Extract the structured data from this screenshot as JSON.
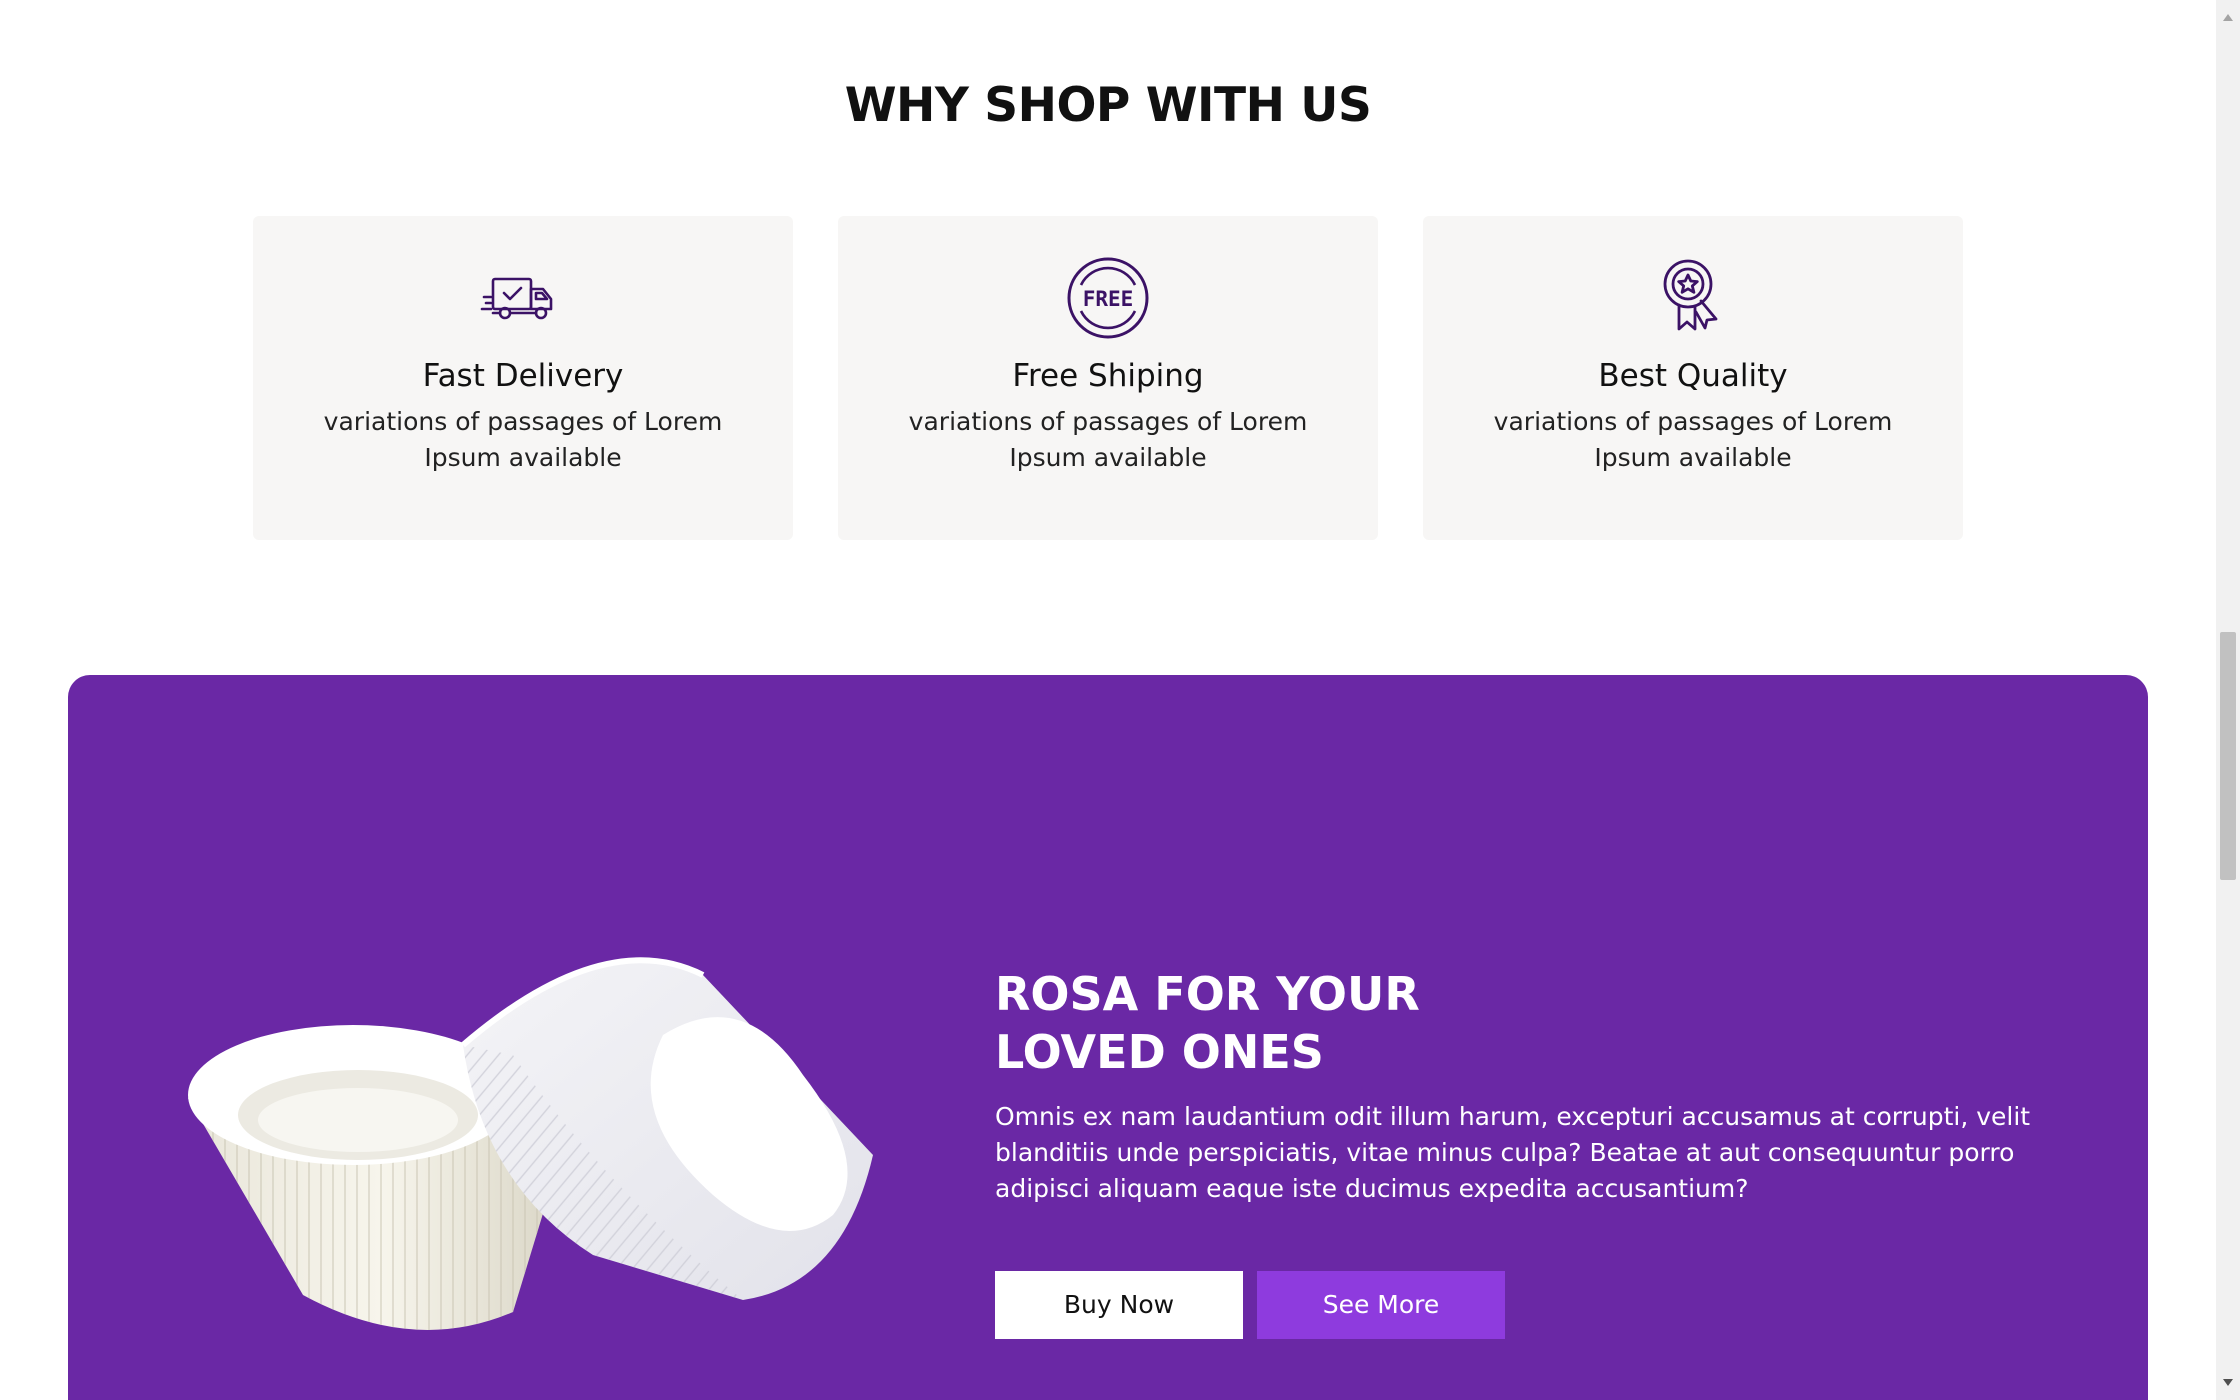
{
  "why_section": {
    "title": "WHY SHOP WITH US",
    "cards": [
      {
        "icon": "delivery-truck-icon",
        "title": "Fast Delivery",
        "description": "variations of passages of Lorem Ipsum available"
      },
      {
        "icon": "free-badge-icon",
        "title": "Free Shiping",
        "description": "variations of passages of Lorem Ipsum available"
      },
      {
        "icon": "quality-medal-icon",
        "title": "Best Quality",
        "description": "variations of passages of Lorem Ipsum available"
      }
    ]
  },
  "promo": {
    "title_line1": "ROSA FOR YOUR",
    "title_line2": "LOVED ONES",
    "text": "Omnis ex nam laudantium odit illum harum, excepturi accusamus at corrupti, velit blanditiis unde perspiciatis, vitae minus culpa? Beatae at aut consequuntur porro adipisci aliquam eaque iste ducimus expedita accusantium?",
    "buy_label": "Buy Now",
    "more_label": "See More",
    "free_icon_text": "FREE"
  },
  "colors": {
    "banner_bg": "#6a28a5",
    "accent_button": "#8e3bde",
    "icon_stroke": "#3b1266",
    "card_bg": "#f7f6f5"
  }
}
